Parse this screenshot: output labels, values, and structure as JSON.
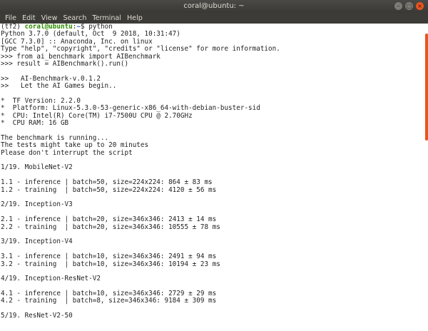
{
  "window": {
    "title": "coral@ubuntu: ~"
  },
  "menu": [
    "File",
    "Edit",
    "View",
    "Search",
    "Terminal",
    "Help"
  ],
  "prompt": {
    "env": "(tf2) ",
    "user_host": "coral@ubuntu",
    "sep": ":",
    "path": "~",
    "end": "$ ",
    "command": "python"
  },
  "lines": [
    "Python 3.7.0 (default, Oct  9 2018, 10:31:47)",
    "[GCC 7.3.0] :: Anaconda, Inc. on linux",
    "Type \"help\", \"copyright\", \"credits\" or \"license\" for more information.",
    ">>> from ai_benchmark import AIBenchmark",
    ">>> result = AIBenchmark().run()",
    "",
    ">>   AI-Benchmark-v.0.1.2",
    ">>   Let the AI Games begin..",
    "",
    "*  TF Version: 2.2.0",
    "*  Platform: Linux-5.3.0-53-generic-x86_64-with-debian-buster-sid",
    "*  CPU: Intel(R) Core(TM) i7-7500U CPU @ 2.70GHz",
    "*  CPU RAM: 16 GB",
    "",
    "The benchmark is running...",
    "The tests might take up to 20 minutes",
    "Please don't interrupt the script",
    "",
    "1/19. MobileNet-V2",
    "",
    "1.1 - inference | batch=50, size=224x224: 864 ± 83 ms",
    "1.2 - training  | batch=50, size=224x224: 4120 ± 56 ms",
    "",
    "2/19. Inception-V3",
    "",
    "2.1 - inference | batch=20, size=346x346: 2413 ± 14 ms",
    "2.2 - training  | batch=20, size=346x346: 10555 ± 78 ms",
    "",
    "3/19. Inception-V4",
    "",
    "3.1 - inference | batch=10, size=346x346: 2491 ± 94 ms",
    "3.2 - training  | batch=10, size=346x346: 10194 ± 23 ms",
    "",
    "4/19. Inception-ResNet-V2",
    "",
    "4.1 - inference | batch=10, size=346x346: 2729 ± 29 ms",
    "4.2 - training  | batch=8, size=346x346: 9184 ± 309 ms",
    "",
    "5/19. ResNet-V2-50"
  ],
  "colors": {
    "accent": "#e95420",
    "user": "#2e8b00",
    "path": "#2c58c7"
  }
}
